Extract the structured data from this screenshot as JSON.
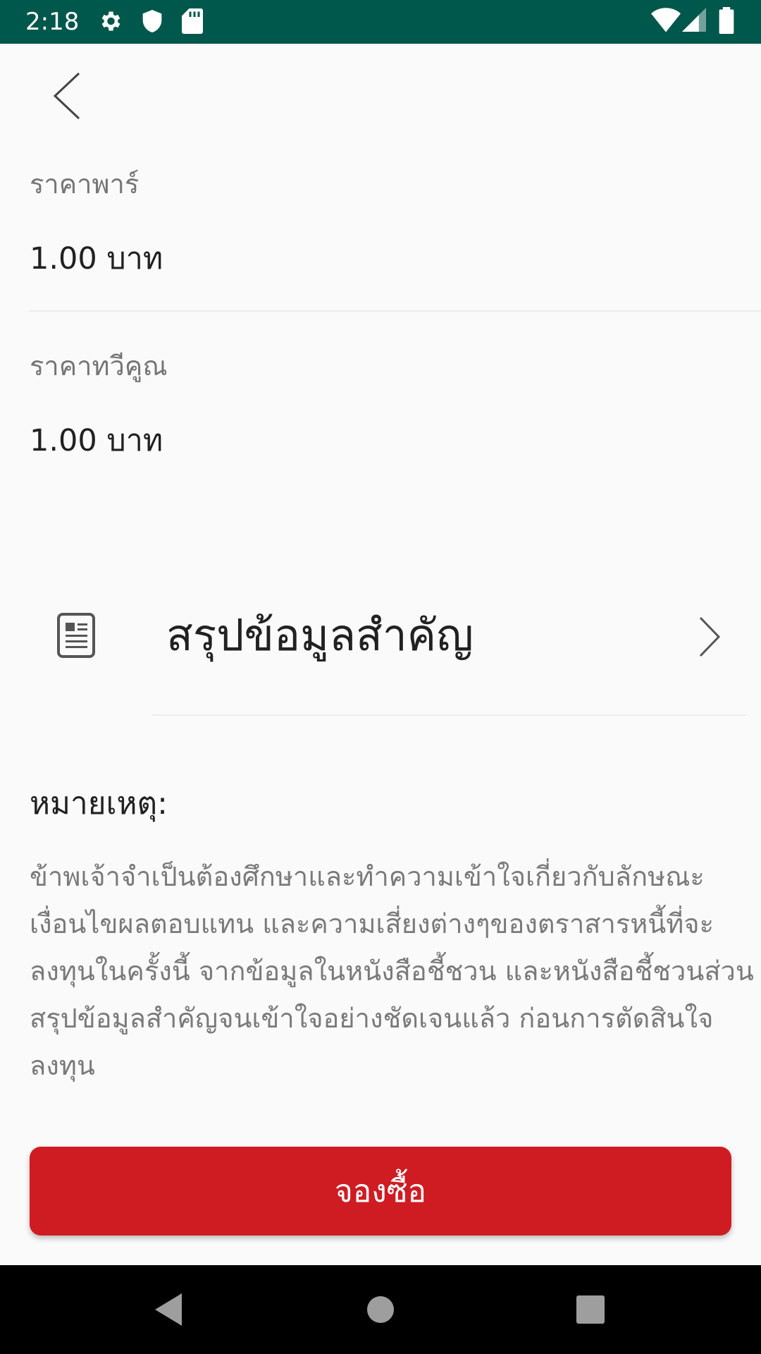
{
  "status_bar": {
    "time": "2:18",
    "icons": [
      "gear-icon",
      "shield-icon",
      "sd-card-icon",
      "wifi-icon",
      "signal-icon",
      "battery-icon"
    ],
    "background": "#00574b"
  },
  "header": {
    "back_icon": "chevron-left-icon"
  },
  "fields": [
    {
      "label": "ราคาพาร์",
      "value": "1.00 บาท"
    },
    {
      "label": "ราคาทวีคูณ",
      "value": "1.00 บาท"
    }
  ],
  "summary": {
    "icon": "document-icon",
    "label": "สรุปข้อมูลสำคัญ",
    "chevron": "chevron-right-icon"
  },
  "note": {
    "title": "หมายเหตุ:",
    "body": "ข้าพเจ้าจำเป็นต้องศึกษาและทำความเข้าใจเกี่ยวกับลักษณะเงื่อนไขผลตอบแทน และความเสี่ยงต่างๆของตราสารหนี้ที่จะลงทุนในครั้งนี้ จากข้อมูลในหนังสือชี้ชวน และหนังสือชี้ชวนส่วนสรุปข้อมูลสำคัญจนเข้าใจอย่างชัดเจนแล้ว ก่อนการตัดสินใจลงทุน"
  },
  "actions": {
    "reserve_label": "จองซื้อ",
    "reserve_color": "#cf1c23"
  },
  "nav_bar": {
    "icons": [
      "back-triangle-icon",
      "home-circle-icon",
      "recents-square-icon"
    ]
  }
}
